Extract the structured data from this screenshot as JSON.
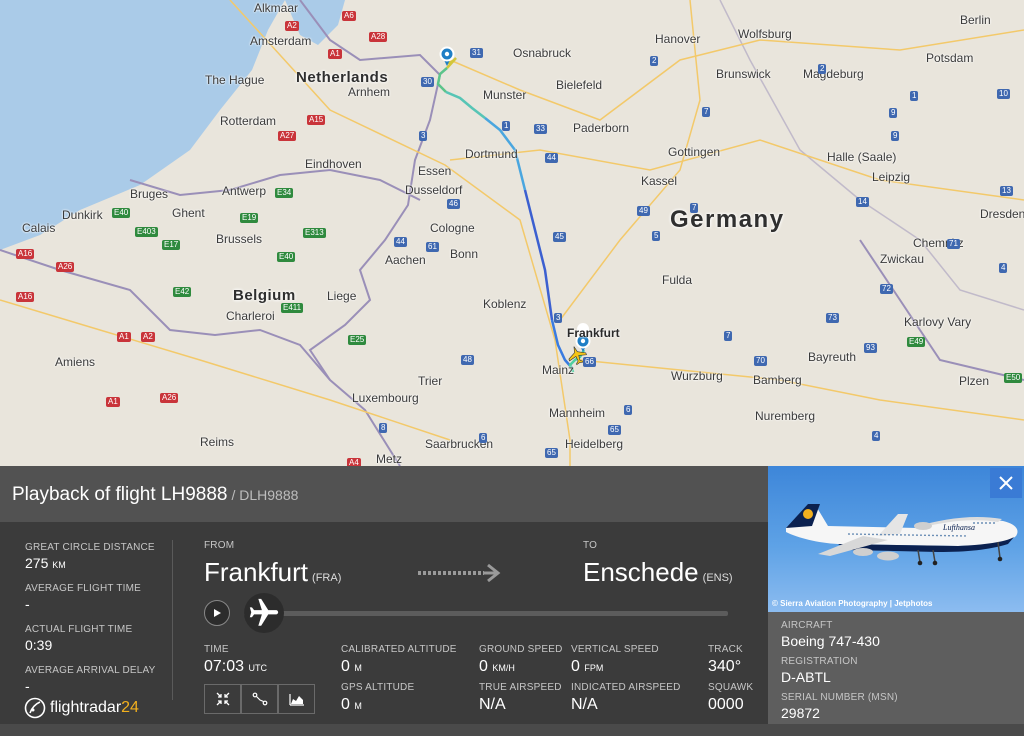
{
  "map": {
    "countries": [
      "Netherlands",
      "Germany",
      "Belgium"
    ],
    "cities": [
      "Alkmaar",
      "Amsterdam",
      "The Hague",
      "Rotterdam",
      "Arnhem",
      "Eindhoven",
      "Antwerp",
      "Bruges",
      "Ghent",
      "Dunkirk",
      "Calais",
      "Brussels",
      "Charleroi",
      "Amiens",
      "Reims",
      "Metz",
      "Luxembourg",
      "Trier",
      "Liege",
      "Aachen",
      "Cologne",
      "Bonn",
      "Koblenz",
      "Essen",
      "Dusseldorf",
      "Dortmund",
      "Munster",
      "Osnabruck",
      "Bielefeld",
      "Paderborn",
      "Hanover",
      "Wolfsburg",
      "Brunswick",
      "Magdeburg",
      "Berlin",
      "Potsdam",
      "Gottingen",
      "Kassel",
      "Halle (Saale)",
      "Leipzig",
      "Dresden",
      "Chemnitz",
      "Zwickau",
      "Karlovy Vary",
      "Plzen",
      "Fulda",
      "Frankfurt",
      "Mainz",
      "Mannheim",
      "Heidelberg",
      "Wurzburg",
      "Bamberg",
      "Bayreuth",
      "Nuremberg",
      "Saarbrucken"
    ],
    "road_labels": [
      "A6",
      "A28",
      "A2",
      "A27",
      "A15",
      "A1",
      "E40",
      "E403",
      "E17",
      "E19",
      "E34",
      "E313",
      "E40",
      "E411",
      "E42",
      "E25",
      "A16",
      "A26",
      "A1",
      "A2",
      "A26",
      "A16",
      "A4",
      "A1",
      "31",
      "30",
      "2",
      "7",
      "1",
      "33",
      "44",
      "46",
      "3",
      "61",
      "44",
      "45",
      "48",
      "5",
      "7",
      "49",
      "66",
      "7",
      "9",
      "70",
      "73",
      "13",
      "72",
      "93",
      "E49",
      "E50",
      "6",
      "3",
      "65",
      "4",
      "1",
      "2",
      "10",
      "9",
      "14",
      "6",
      "8",
      "4",
      "71",
      "65"
    ]
  },
  "header": {
    "title": "Playback of flight LH9888",
    "callsign": "/ DLH9888"
  },
  "stats": [
    {
      "label": "GREAT CIRCLE DISTANCE",
      "value": "275",
      "unit": "KM"
    },
    {
      "label": "AVERAGE FLIGHT TIME",
      "value": "-",
      "unit": ""
    },
    {
      "label": "ACTUAL FLIGHT TIME",
      "value": "0:39",
      "unit": ""
    },
    {
      "label": "AVERAGE ARRIVAL DELAY",
      "value": "-",
      "unit": ""
    }
  ],
  "route": {
    "from_label": "FROM",
    "from_city": "Frankfurt",
    "from_code": "(FRA)",
    "to_label": "TO",
    "to_city": "Enschede",
    "to_code": "(ENS)"
  },
  "playback": {
    "progress": 0
  },
  "metrics": {
    "time_label": "TIME",
    "time_value": "07:03",
    "time_unit": "UTC",
    "cal_alt_label": "CALIBRATED ALTITUDE",
    "cal_alt_value": "0",
    "cal_alt_unit": "M",
    "gps_alt_label": "GPS ALTITUDE",
    "gps_alt_value": "0",
    "gps_alt_unit": "M",
    "ground_speed_label": "GROUND SPEED",
    "ground_speed_value": "0",
    "ground_speed_unit": "KM/H",
    "true_airspeed_label": "TRUE AIRSPEED",
    "true_airspeed_value": "N/A",
    "vert_speed_label": "VERTICAL SPEED",
    "vert_speed_value": "0",
    "vert_speed_unit": "FPM",
    "ind_airspeed_label": "INDICATED AIRSPEED",
    "ind_airspeed_value": "N/A",
    "track_label": "TRACK",
    "track_value": "340°",
    "squawk_label": "SQUAWK",
    "squawk_value": "0000"
  },
  "logo": {
    "name": "flightradar",
    "suffix": "24"
  },
  "aircraft": {
    "photo_credit": "© Sierra Aviation Photography | Jetphotos",
    "livery_text": "Lufthansa",
    "aircraft_label": "AIRCRAFT",
    "aircraft_value": "Boeing 747-430",
    "registration_label": "REGISTRATION",
    "registration_value": "D-ABTL",
    "serial_label": "SERIAL NUMBER (MSN)",
    "serial_value": "29872"
  },
  "colors": {
    "accent": "#3a7bd5",
    "brand": "#f2b01e",
    "panel_dark": "#3b3b3b",
    "header": "#525252"
  },
  "icons": [
    "play-icon",
    "airplane-icon",
    "close-icon",
    "fit-view-icon",
    "route-icon",
    "graph-icon",
    "map-pin-icon"
  ]
}
